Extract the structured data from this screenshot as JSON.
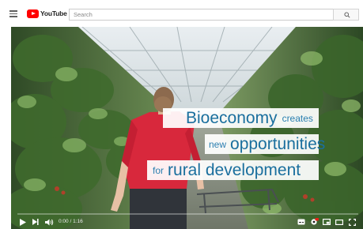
{
  "header": {
    "logo_text": "YouTube",
    "search": {
      "placeholder": "Search",
      "value": ""
    }
  },
  "video": {
    "captions": [
      {
        "big": "Bioeconomy",
        "small": "creates"
      },
      {
        "small": "new",
        "big": "opportunities"
      },
      {
        "small": "for",
        "big": "rural development"
      }
    ],
    "player": {
      "time_display": "0:00 / 1:16",
      "progress_fraction": 0.0
    }
  },
  "icons": {
    "menu": "menu-icon",
    "logo": "youtube-logo-icon",
    "search": "search-icon",
    "play": "play-icon",
    "next": "next-icon",
    "volume": "volume-icon",
    "subtitles": "subtitles-icon",
    "settings": "settings-icon",
    "miniplayer": "miniplayer-icon",
    "theater": "theater-mode-icon",
    "fullscreen": "fullscreen-icon"
  },
  "colors": {
    "brand_red": "#ff0000",
    "caption_text": "#1a6f9e",
    "shirt": "#d8283c"
  }
}
